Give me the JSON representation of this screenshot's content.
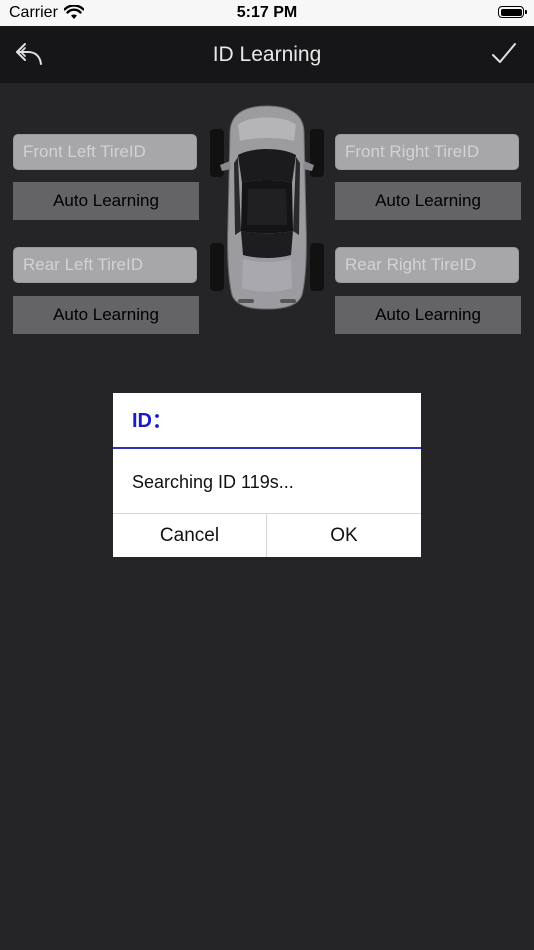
{
  "status_bar": {
    "carrier": "Carrier",
    "time": "5:17 PM"
  },
  "nav": {
    "title": "ID Learning",
    "back_icon": "back-arrow-icon",
    "confirm_icon": "checkmark-icon"
  },
  "tires": {
    "front_left": {
      "placeholder": "Front Left TireID",
      "button": "Auto Learning"
    },
    "front_right": {
      "placeholder": "Front Right TireID",
      "button": "Auto Learning"
    },
    "rear_left": {
      "placeholder": "Rear Left TireID",
      "button": "Auto Learning"
    },
    "rear_right": {
      "placeholder": "Rear Right TireID",
      "button": "Auto Learning"
    }
  },
  "dialog": {
    "title": "ID：",
    "message": "Searching ID  119s...",
    "cancel": "Cancel",
    "ok": "OK"
  },
  "colors": {
    "dialog_title": "#1a1ac7",
    "dialog_divider": "#2f2fbd",
    "background": "#252527"
  }
}
